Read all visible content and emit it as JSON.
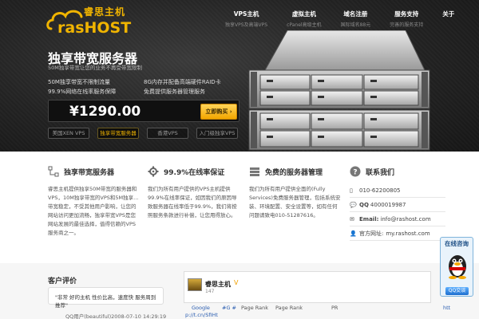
{
  "logo": {
    "brand": "rasHOST",
    "cn": "睿思主机"
  },
  "nav": [
    {
      "title": "VPS主机",
      "sub": "独享VPS及高端VPS"
    },
    {
      "title": "虚拟主机",
      "sub": "cPanel高级主机"
    },
    {
      "title": "域名注册",
      "sub": "国际域名88元"
    },
    {
      "title": "服务支持",
      "sub": "完善的服务支持"
    },
    {
      "title": "关于",
      "sub": ""
    }
  ],
  "hero": {
    "title": "独享带宽服务器",
    "subtitle": "50M独享带宽让您的业务不再受带宽限制",
    "features": [
      "50M独享带宽不限制流量",
      "8G内存并配备高端硬件RAID卡",
      "99.9%网络在线率服务保障",
      "免费提供服务器管理服务"
    ],
    "price": "¥1290.00",
    "buy_label": "立即购买 ›",
    "tabs": [
      "美国XEN VPS",
      "独享带宽服务器",
      "香港VPS",
      "入门级独享VPS"
    ]
  },
  "columns": [
    {
      "title": "独享带宽服务器",
      "icon": "network-icon",
      "text": "睿思主机提供独享50M带宽的服务器和VPS，10M独享带宽的VPS和5M独享… 带宽稳定，不受其他用户影响，让您的网站访问更加流畅，独享带宽VPS是您网站发展的最佳选择，值得信赖的VPS服务商之一。"
    },
    {
      "title": "99.9%在线率保证",
      "icon": "gear-icon",
      "text": "我们为所有用户提供的VPS主机提供99.9%在线率保证，如因我们的原因导致服务器在线率低于99.9%，我们将按照服务条款进行补偿，让您用得放心。"
    },
    {
      "title": "免费的服务器管理",
      "icon": "server-icon",
      "text": "我们为所有用户提供全面的(Fully Services)免费服务器管理，包括系统安装、环境配置、安全设置等，如有任何问题请致电010-51287616。"
    }
  ],
  "contact": {
    "title": "联系我们",
    "phone": "010-62200805",
    "qq_label": "QQ",
    "qq": "4000019987",
    "email_label": "Email:",
    "email": "info@rashost.com",
    "site_label": "官方网址:",
    "site": "my.rashost.com"
  },
  "news": {
    "title": "客户评价",
    "quote": "\"非常 好的主机 性价比高，速度快 服务周到 推荐\"",
    "meta": "QQ用户(beautiful)2008-07-10 14:29:19"
  },
  "weibo": {
    "name": "睿思主机",
    "count": "147",
    "ticker": [
      "Google",
      "#G #",
      "Page Rank",
      "Page Rank",
      "PR",
      "htt",
      "p://t.cn/SfIHt"
    ]
  },
  "consult": {
    "title": "在线咨询",
    "qq_btn": "QQ交谈"
  },
  "colors": {
    "accent": "#f0b400",
    "dark": "#1e1e1e",
    "link": "#2a5db0"
  }
}
